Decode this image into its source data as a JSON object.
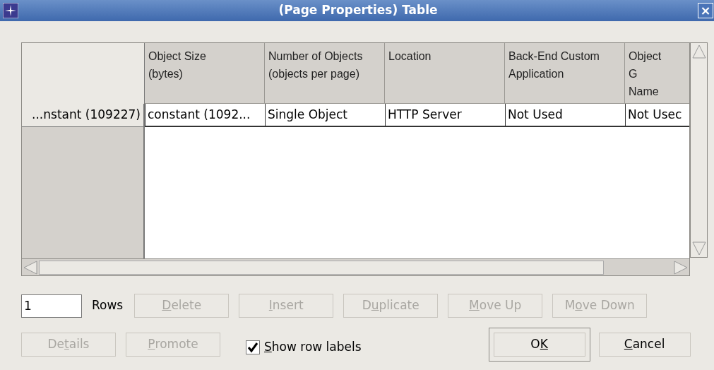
{
  "window": {
    "title": "(Page Properties) Table",
    "close": "×"
  },
  "table": {
    "columns": [
      "Object Size (bytes)",
      "Number of Objects (objects per page)",
      "Location",
      "Back-End Custom Application",
      "Object G Name"
    ],
    "rows": [
      {
        "label": "...nstant (109227)",
        "cells": [
          "constant (1092...",
          "Single Object",
          "HTTP Server",
          "Not Used",
          "Not Usec"
        ]
      }
    ]
  },
  "rows_field": {
    "value": "1",
    "label": "Rows"
  },
  "row_buttons": [
    {
      "key": "D",
      "after": "elete",
      "disabled": true
    },
    {
      "key": "I",
      "after": "nsert",
      "disabled": true
    },
    {
      "before": "D",
      "key": "u",
      "after": "plicate",
      "disabled": true
    },
    {
      "key": "M",
      "after": "ove Up",
      "disabled": true
    },
    {
      "before": "M",
      "key": "o",
      "after": "ve Down",
      "disabled": true
    }
  ],
  "left_buttons": [
    {
      "before": "De",
      "key": "t",
      "after": "ails",
      "disabled": true
    },
    {
      "key": "P",
      "after": "romote",
      "disabled": true
    }
  ],
  "show_row_labels": {
    "key": "S",
    "after": "how row labels",
    "checked": true
  },
  "dialog_buttons": [
    {
      "before": "O",
      "key": "K",
      "default": true
    },
    {
      "key": "C",
      "after": "ancel",
      "default": false
    }
  ]
}
